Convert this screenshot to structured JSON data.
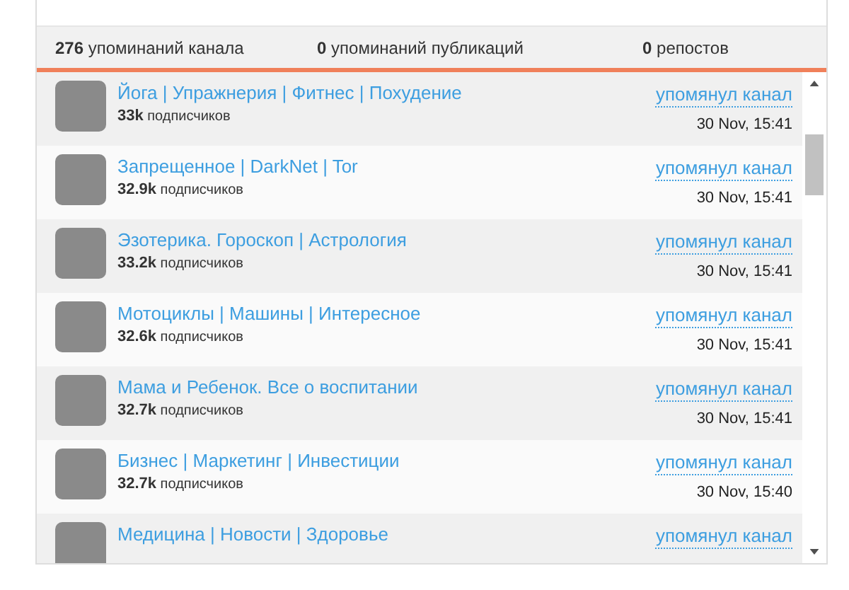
{
  "stats": [
    "**276** упоминаний канала",
    "**0** упоминаний публикаций",
    "**0** репостов"
  ],
  "mentions": [
    {
      "title": "Йога | Упражнерия | Фитнес | Похудение",
      "count": "33k",
      "subs": "подписчиков",
      "action": "упомянул канал",
      "time": "30 Nov, 15:41"
    },
    {
      "title": "Запрещенное | DarkNet | Tor",
      "count": "32.9k",
      "subs": "подписчиков",
      "action": "упомянул канал",
      "time": "30 Nov, 15:41"
    },
    {
      "title": "Эзотерика. Гороскоп | Астрология",
      "count": "33.2k",
      "subs": "подписчиков",
      "action": "упомянул канал",
      "time": "30 Nov, 15:41"
    },
    {
      "title": "Мотоциклы | Машины | Интересное",
      "count": "32.6k",
      "subs": "подписчиков",
      "action": "упомянул канал",
      "time": "30 Nov, 15:41"
    },
    {
      "title": "Мама и Ребенок. Все о воспитании",
      "count": "32.7k",
      "subs": "подписчиков",
      "action": "упомянул канал",
      "time": "30 Nov, 15:41"
    },
    {
      "title": "Бизнес | Маркетинг | Инвестиции",
      "count": "32.7k",
      "subs": "подписчиков",
      "action": "упомянул канал",
      "time": "30 Nov, 15:40"
    },
    {
      "title": "Медицина | Новости | Здоровье",
      "action": "упомянул канал"
    }
  ]
}
